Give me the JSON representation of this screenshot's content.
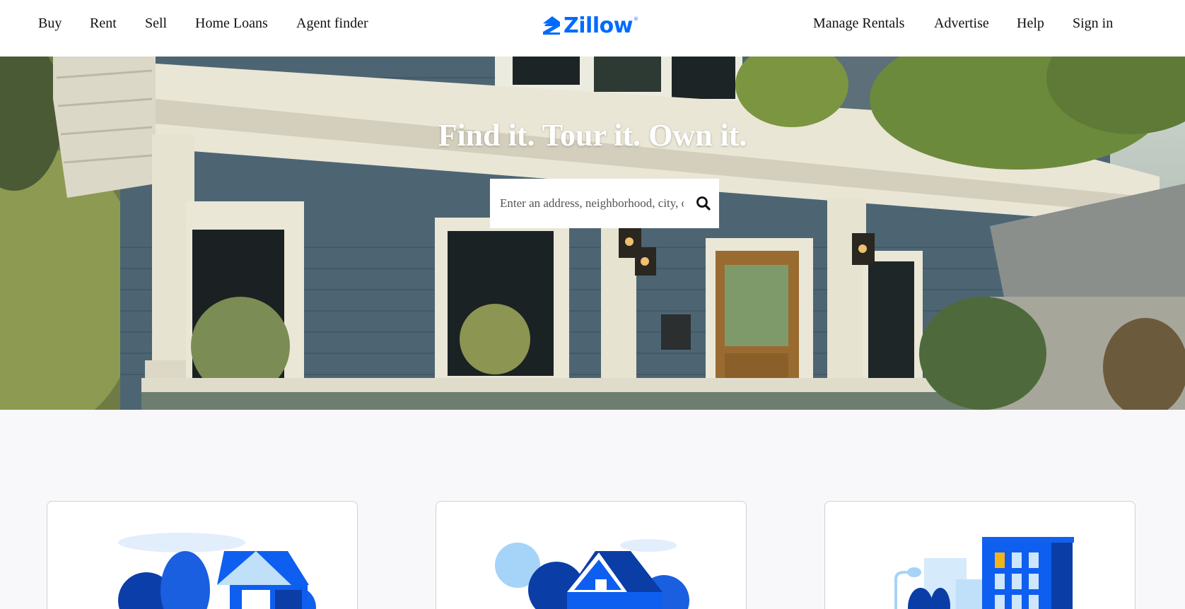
{
  "nav": {
    "left": [
      "Buy",
      "Rent",
      "Sell",
      "Home Loans",
      "Agent finder"
    ],
    "right": [
      "Manage Rentals",
      "Advertise",
      "Help",
      "Sign in"
    ],
    "logo": "Zillow",
    "brand_color": "#006aff"
  },
  "hero": {
    "title": "Find it. Tour it. Own it.",
    "search_placeholder": "Enter an address, neighborhood, city, or ZIP code",
    "search_icon": "search-icon"
  },
  "cards": [
    {
      "illustration": "buy-home-illustration"
    },
    {
      "illustration": "sell-home-illustration"
    },
    {
      "illustration": "rent-building-illustration"
    }
  ]
}
